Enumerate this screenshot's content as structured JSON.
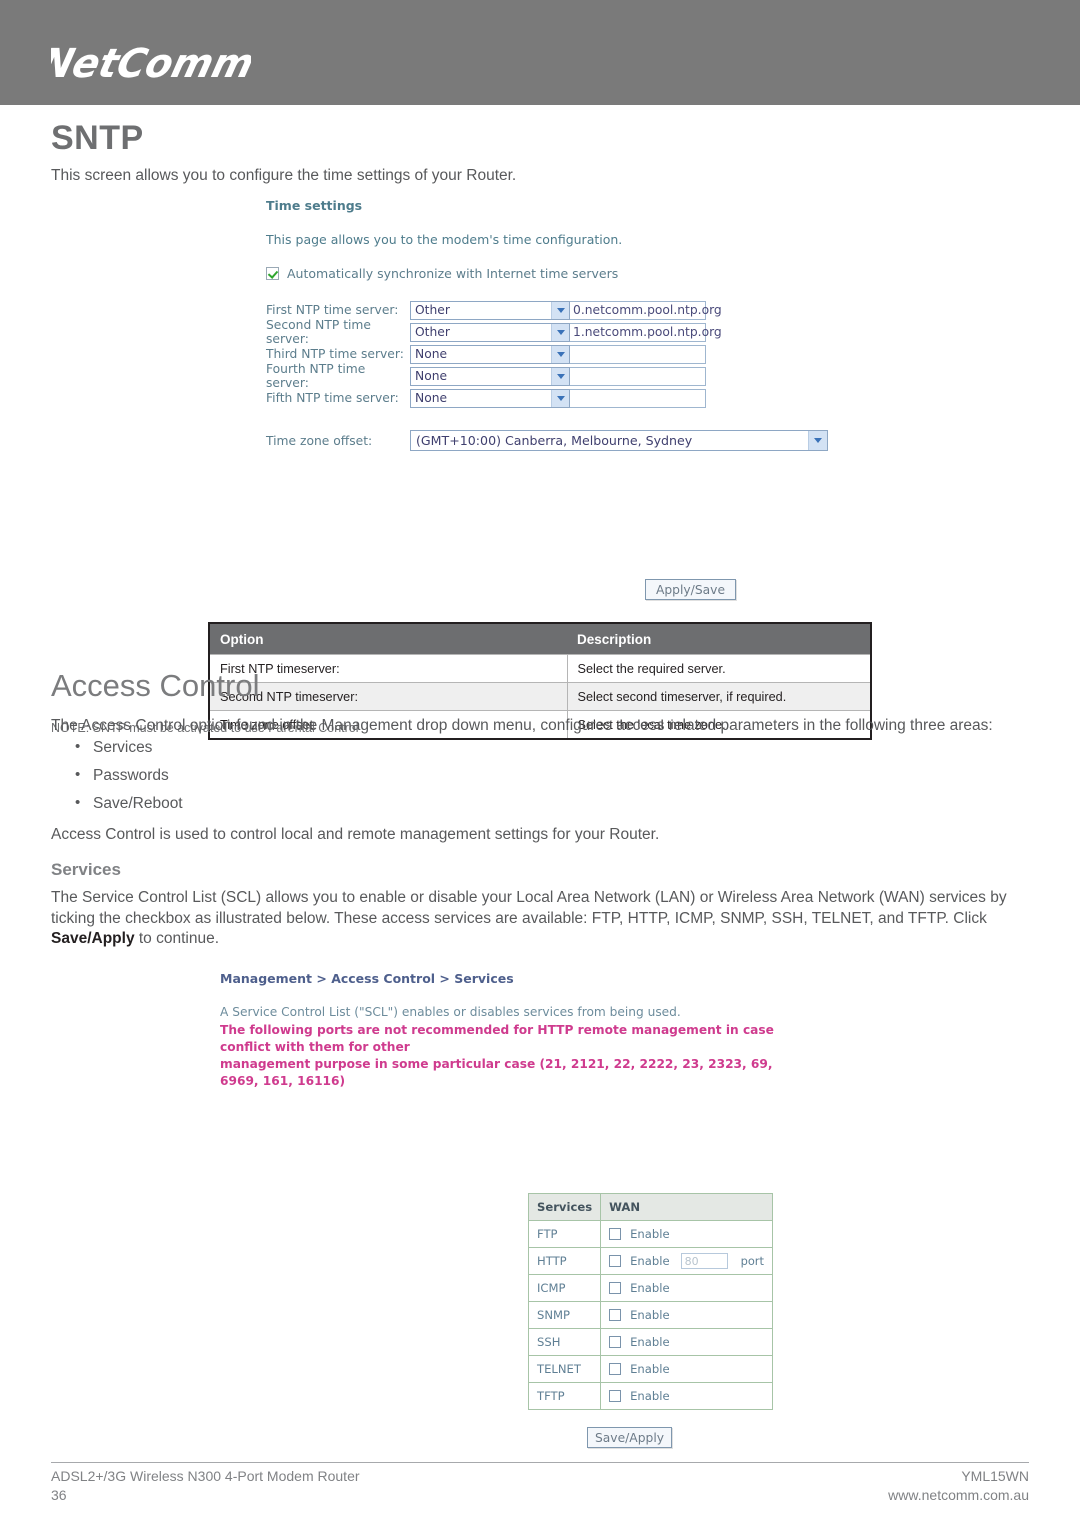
{
  "header": {
    "logo_text": "NetComm",
    "background_color": "#7a7a7a"
  },
  "page": {
    "title": "SNTP",
    "intro": "This screen allows you to configure the time settings of your Router."
  },
  "time_settings_ui": {
    "heading": "Time settings",
    "subheading": "This page allows you to the modem's time configuration.",
    "auto_sync_label": "Automatically synchronize with Internet time servers",
    "auto_sync_checked": true,
    "rows": [
      {
        "label": "First NTP time server:",
        "select": "Other",
        "value": "0.netcomm.pool.ntp.org"
      },
      {
        "label": "Second NTP time server:",
        "select": "Other",
        "value": "1.netcomm.pool.ntp.org"
      },
      {
        "label": "Third NTP time server:",
        "select": "None",
        "value": ""
      },
      {
        "label": "Fourth NTP time server:",
        "select": "None",
        "value": ""
      },
      {
        "label": "Fifth NTP time server:",
        "select": "None",
        "value": ""
      }
    ],
    "timezone_label": "Time zone offset:",
    "timezone_value": "(GMT+10:00) Canberra, Melbourne, Sydney",
    "apply_button": "Apply/Save"
  },
  "option_table": {
    "headers": [
      "Option",
      "Description"
    ],
    "rows": [
      [
        "First NTP timeserver:",
        "Select the required server."
      ],
      [
        "Second NTP timeserver:",
        "Select second timeserver, if required."
      ],
      [
        "Time zone offset:",
        "Select the local time zone."
      ]
    ]
  },
  "note": "NOTE: SNTP must be activated to use Parental Control",
  "access_control": {
    "title": "Access Control",
    "intro": "The Access Control option found in the Management drop down menu, configures access related parameters in the following three areas:",
    "bullets": [
      "Services",
      "Passwords",
      "Save/Reboot"
    ],
    "used_for": "Access Control is used to control local and remote management settings for your Router.",
    "services_heading": "Services",
    "services_desc_part1": "The Service Control List (SCL) allows you to enable or disable your Local Area Network (LAN) or Wireless Area Network (WAN) services by ticking the checkbox as illustrated below. These access services are available: FTP, HTTP, ICMP, SNMP, SSH, TELNET, and TFTP. Click ",
    "services_desc_bold": "Save/Apply",
    "services_desc_part2": " to continue."
  },
  "scl_ui": {
    "breadcrumb": "Management > Access Control > Services",
    "note": "A Service Control List (\"SCL\") enables or disables services from being used.",
    "warning_line1": "The following ports are not recommended for HTTP remote management in case conflict with them for other",
    "warning_line2": "management purpose in some particular case (21, 2121, 22, 2222, 23, 2323, 69, 6969, 161, 16116)",
    "warning_color": "#cf3b8e",
    "table": {
      "headers": [
        "Services",
        "WAN"
      ],
      "enable_label": "Enable",
      "port_label": "port",
      "rows": [
        {
          "service": "FTP",
          "enabled": false,
          "port": null
        },
        {
          "service": "HTTP",
          "enabled": false,
          "port": "80"
        },
        {
          "service": "ICMP",
          "enabled": false,
          "port": null
        },
        {
          "service": "SNMP",
          "enabled": false,
          "port": null
        },
        {
          "service": "SSH",
          "enabled": false,
          "port": null
        },
        {
          "service": "TELNET",
          "enabled": false,
          "port": null
        },
        {
          "service": "TFTP",
          "enabled": false,
          "port": null
        }
      ]
    },
    "save_button": "Save/Apply"
  },
  "footer": {
    "product": "ADSL2+/3G Wireless N300 4-Port Modem Router",
    "page_number": "36",
    "doc_code": "YML15WN",
    "website": "www.netcomm.com.au"
  }
}
